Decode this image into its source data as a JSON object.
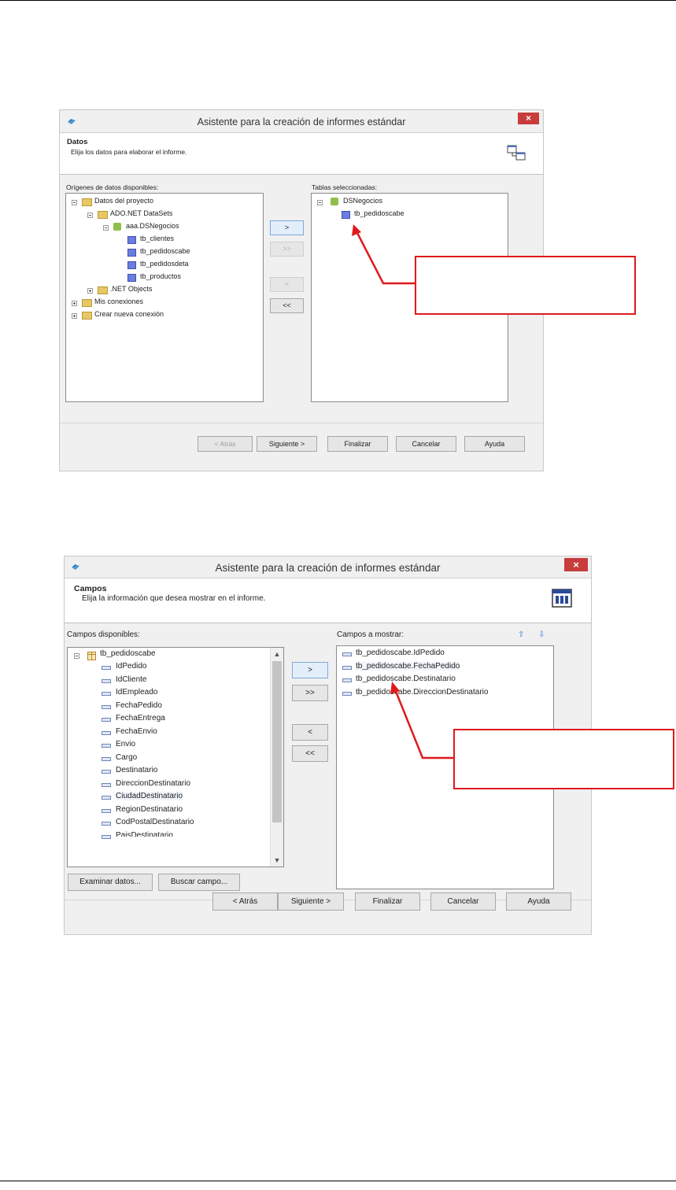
{
  "dialog1": {
    "title": "Asistente para la creación de informes estándar",
    "close": "×",
    "header_title": "Datos",
    "header_sub": "Elija los datos para elaborar el informe.",
    "left_label": "Orígenes de datos disponibles:",
    "right_label": "Tablas seleccionadas:",
    "tree": [
      {
        "label": "Datos del proyecto",
        "icon": "folder-icon"
      },
      {
        "label": "ADO.NET DataSets",
        "icon": "folder-icon"
      },
      {
        "label": "aaa.DSNegocios",
        "icon": "dataset-icon"
      },
      {
        "label": "tb_clientes",
        "icon": "table-icon"
      },
      {
        "label": "tb_pedidoscabe",
        "icon": "table-icon"
      },
      {
        "label": "tb_pedidosdeta",
        "icon": "table-icon"
      },
      {
        "label": "tb_productos",
        "icon": "table-icon"
      },
      {
        "label": ".NET Objects",
        "icon": "folder-icon"
      },
      {
        "label": "Mis conexiones",
        "icon": "folder-icon"
      },
      {
        "label": "Crear nueva conexión",
        "icon": "folder-icon"
      }
    ],
    "selected_tree": [
      {
        "label": "DSNegocios",
        "icon": "dataset-icon"
      },
      {
        "label": "tb_pedidoscabe",
        "icon": "table-icon"
      }
    ],
    "move_buttons": [
      ">",
      ">>",
      "<",
      "<<"
    ],
    "footer_buttons": [
      "< Atrás",
      "Siguiente >",
      "Finalizar",
      "Cancelar",
      "Ayuda"
    ]
  },
  "dialog2": {
    "title": "Asistente para la creación de informes estándar",
    "close": "×",
    "header_title": "Campos",
    "header_sub": "Elija la información que desea mostrar en el informe.",
    "left_label": "Campos disponibles:",
    "right_label": "Campos a mostrar:",
    "table_name": "tb_pedidoscabe",
    "fields": [
      "IdPedido",
      "IdCliente",
      "IdEmpleado",
      "FechaPedido",
      "FechaEntrega",
      "FechaEnvio",
      "Envio",
      "Cargo",
      "Destinatario",
      "DireccionDestinatario",
      "CiudadDestinatario",
      "RegionDestinatario",
      "CodPostalDestinatario",
      "PaisDestinatario"
    ],
    "selected_fields": [
      "tb_pedidoscabe.IdPedido",
      "tb_pedidoscabe.FechaPedido",
      "tb_pedidoscabe.Destinatario",
      "tb_pedidoscabe.DireccionDestinatario"
    ],
    "move_buttons": [
      ">",
      ">>",
      "<",
      "<<"
    ],
    "browse_buttons": [
      "Examinar datos...",
      "Buscar campo..."
    ],
    "footer_buttons": [
      "< Atrás",
      "Siguiente >",
      "Finalizar",
      "Cancelar",
      "Ayuda"
    ]
  },
  "colors": {
    "callout": "#e0191c",
    "close": "#c83c3c",
    "table_icon": "#6a7ee0",
    "folder_icon": "#e8c865"
  }
}
